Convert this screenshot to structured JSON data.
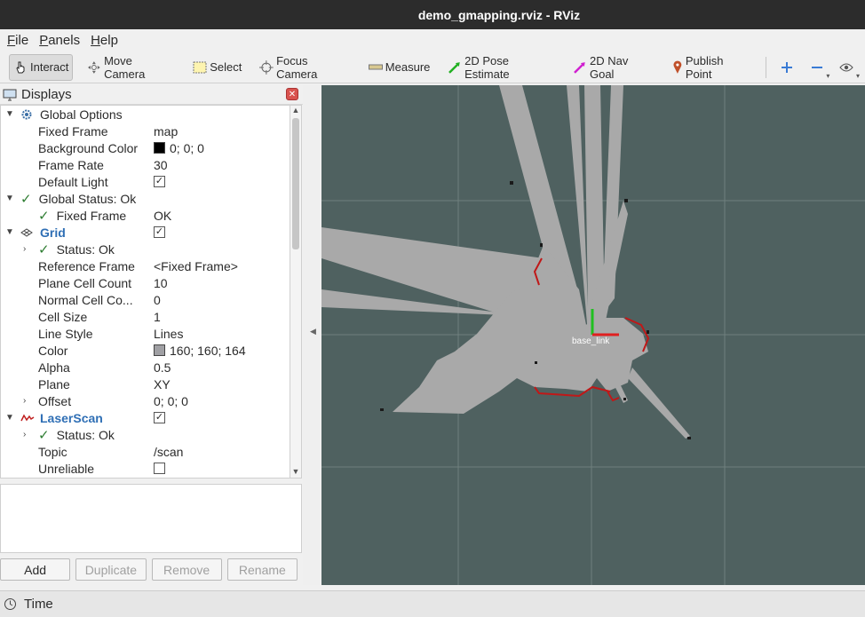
{
  "window": {
    "title": "demo_gmapping.rviz - RViz"
  },
  "menu": [
    {
      "key": "F",
      "rest": "ile"
    },
    {
      "key": "P",
      "rest": "anels"
    },
    {
      "key": "H",
      "rest": "elp"
    }
  ],
  "toolbar": {
    "interact": "Interact",
    "move_camera": "Move Camera",
    "select": "Select",
    "focus_camera": "Focus Camera",
    "measure": "Measure",
    "pose_estimate": "2D Pose Estimate",
    "nav_goal": "2D Nav Goal",
    "publish_point": "Publish Point"
  },
  "displays": {
    "title": "Displays",
    "global_options": "Global Options",
    "fixed_frame_label": "Fixed Frame",
    "fixed_frame_value": "map",
    "bg_color_label": "Background Color",
    "bg_color_value": "0; 0; 0",
    "frame_rate_label": "Frame Rate",
    "frame_rate_value": "30",
    "default_light_label": "Default Light",
    "global_status": "Global Status: Ok",
    "gs_fixed_frame_label": "Fixed Frame",
    "gs_fixed_frame_value": "OK",
    "grid": "Grid",
    "grid_status": "Status: Ok",
    "ref_frame_label": "Reference Frame",
    "ref_frame_value": "<Fixed Frame>",
    "plane_cell_count_label": "Plane Cell Count",
    "plane_cell_count_value": "10",
    "normal_cell_label": "Normal Cell Co...",
    "normal_cell_value": "0",
    "cell_size_label": "Cell Size",
    "cell_size_value": "1",
    "line_style_label": "Line Style",
    "line_style_value": "Lines",
    "color_label": "Color",
    "color_value": "160; 160; 164",
    "alpha_label": "Alpha",
    "alpha_value": "0.5",
    "plane_label": "Plane",
    "plane_value": "XY",
    "offset_label": "Offset",
    "offset_value": "0; 0; 0",
    "laserscan": "LaserScan",
    "ls_status": "Status: Ok",
    "topic_label": "Topic",
    "topic_value": "/scan",
    "unreliable_label": "Unreliable"
  },
  "buttons": {
    "add": "Add",
    "duplicate": "Duplicate",
    "remove": "Remove",
    "rename": "Rename"
  },
  "view": {
    "frame_label": "base_link"
  },
  "time_panel": {
    "title": "Time"
  },
  "colors": {
    "view_bg": "#4f6160",
    "map_free": "#a9a9a9",
    "grid_color": "#a0a0a4",
    "axis_x": "#e02020",
    "axis_y": "#20c020"
  }
}
